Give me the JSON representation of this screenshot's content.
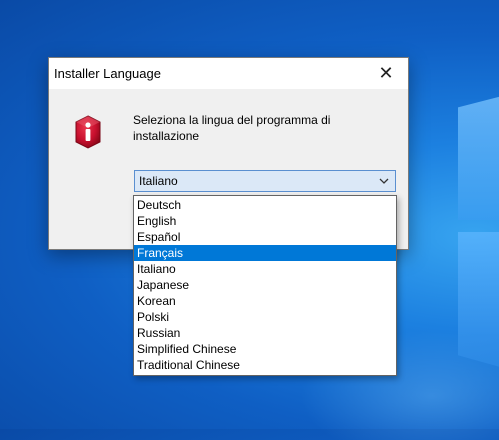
{
  "dialog": {
    "title": "Installer Language",
    "close_glyph": "✕",
    "message": "Seleziona la lingua del programma di installazione",
    "icon": "info-icon"
  },
  "combo": {
    "value": "Italiano",
    "arrow_icon": "chevron-down-icon"
  },
  "dropdown": {
    "options": [
      {
        "label": "Deutsch",
        "selected": false
      },
      {
        "label": "English",
        "selected": false
      },
      {
        "label": "Español",
        "selected": false
      },
      {
        "label": "Français",
        "selected": true
      },
      {
        "label": "Italiano",
        "selected": false
      },
      {
        "label": "Japanese",
        "selected": false
      },
      {
        "label": "Korean",
        "selected": false
      },
      {
        "label": "Polski",
        "selected": false
      },
      {
        "label": "Russian",
        "selected": false
      },
      {
        "label": "Simplified Chinese",
        "selected": false
      },
      {
        "label": "Traditional Chinese",
        "selected": false
      }
    ]
  },
  "colors": {
    "selection": "#0078d7",
    "info_icon": "#c8102e",
    "desktop": "#1c80e0"
  }
}
